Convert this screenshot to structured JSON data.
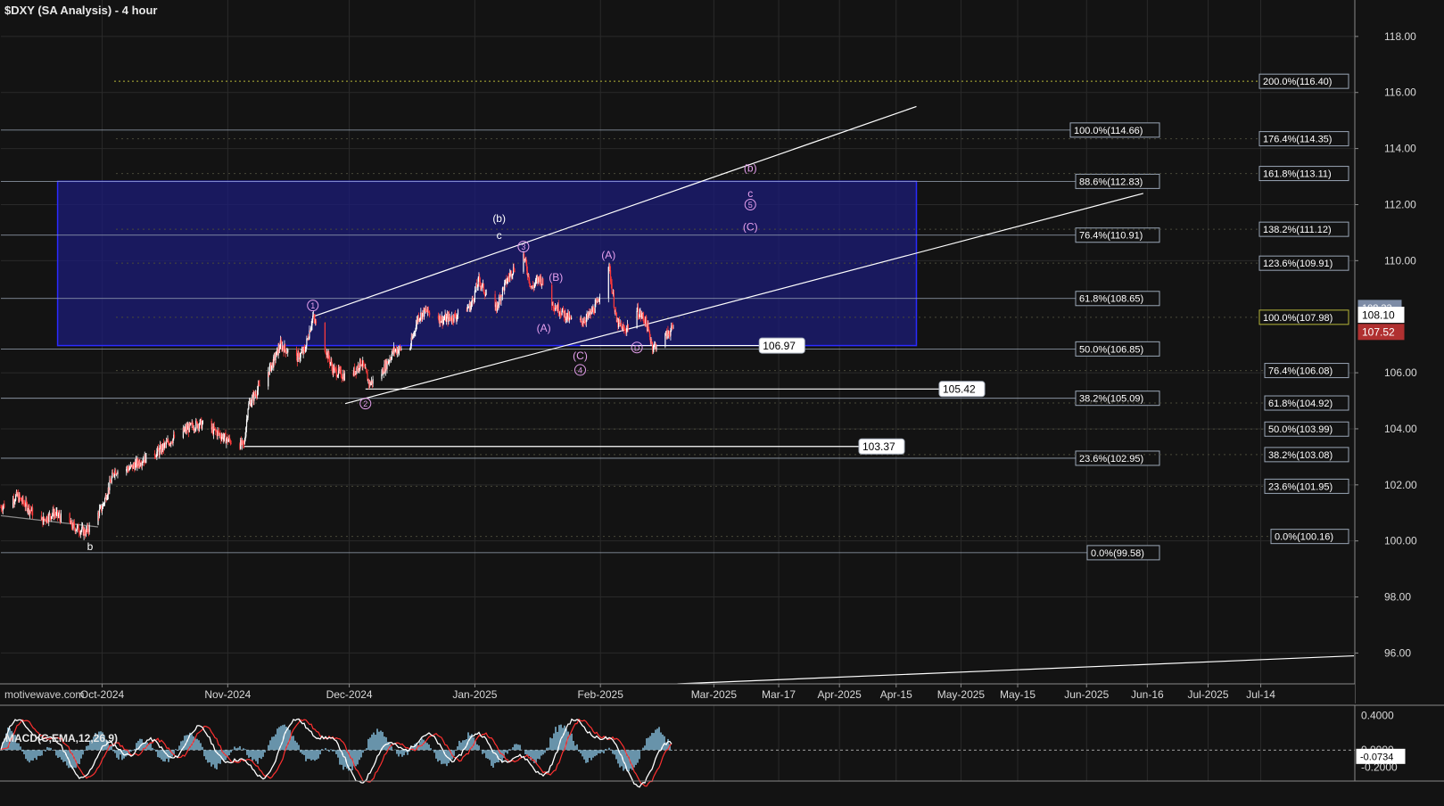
{
  "title": "$DXY (SA Analysis) - 4 hour",
  "watermark": "motivewave.com",
  "macd_title": "MACD(C,EMA,12,26,9)",
  "colors": {
    "background": "#131313",
    "grid": "#2a2a2a",
    "candle_up": "#ffffff",
    "candle_down": "#ff3b3b",
    "box_fill": "#1c1c78",
    "box_border": "#2a2aff",
    "fib_line": "#9aa6b6",
    "yellow_dotted": "#b5b53a",
    "wave_pink": "#e6a0ee",
    "wave_white": "#ffffff",
    "price_badge_red": "#b03030",
    "price_badge_gray": "#7d8ca6",
    "macd_line": "#ffffff",
    "signal_line": "#ff3030",
    "histogram": "#7fb4d0"
  },
  "chart_data": {
    "type": "line",
    "instrument": "$DXY",
    "timeframe": "4 hour",
    "x_axis": {
      "labels": [
        "Oct-2024",
        "Nov-2024",
        "Dec-2024",
        "Jan-2025",
        "Feb-2025",
        "Mar-2025",
        "Mar-17",
        "Apr-2025",
        "Apr-15",
        "May-2025",
        "May-15",
        "Jun-2025",
        "Jun-16",
        "Jul-2025",
        "Jul-14"
      ],
      "dates": [
        "2024-10-01",
        "2024-11-01",
        "2024-12-01",
        "2025-01-01",
        "2025-02-01",
        "2025-03-01",
        "2025-03-17",
        "2025-04-01",
        "2025-04-15",
        "2025-05-01",
        "2025-05-15",
        "2025-06-01",
        "2025-06-16",
        "2025-07-01",
        "2025-07-14"
      ]
    },
    "y_axis": {
      "ticks": [
        "118.00",
        "116.00",
        "114.00",
        "112.00",
        "110.00",
        "106.00",
        "104.00",
        "102.00",
        "100.00",
        "98.00",
        "96.00"
      ],
      "ylim": [
        94.9,
        119.3
      ]
    },
    "price_path": [
      {
        "date": "2024-09-06",
        "price": 101.2
      },
      {
        "date": "2024-09-10",
        "price": 101.6
      },
      {
        "date": "2024-09-12",
        "price": 101.3
      },
      {
        "date": "2024-09-16",
        "price": 100.7
      },
      {
        "date": "2024-09-19",
        "price": 101.0
      },
      {
        "date": "2024-09-24",
        "price": 100.5
      },
      {
        "date": "2024-09-27",
        "price": 100.3
      },
      {
        "date": "2024-10-01",
        "price": 101.2
      },
      {
        "date": "2024-10-04",
        "price": 102.5
      },
      {
        "date": "2024-10-08",
        "price": 102.6
      },
      {
        "date": "2024-10-11",
        "price": 102.9
      },
      {
        "date": "2024-10-15",
        "price": 103.2
      },
      {
        "date": "2024-10-18",
        "price": 103.6
      },
      {
        "date": "2024-10-22",
        "price": 104.0
      },
      {
        "date": "2024-10-25",
        "price": 104.2
      },
      {
        "date": "2024-10-29",
        "price": 103.9
      },
      {
        "date": "2024-11-01",
        "price": 103.6
      },
      {
        "date": "2024-11-05",
        "price": 103.4
      },
      {
        "date": "2024-11-06",
        "price": 104.8
      },
      {
        "date": "2024-11-08",
        "price": 105.3
      },
      {
        "date": "2024-11-12",
        "price": 106.3
      },
      {
        "date": "2024-11-14",
        "price": 107.0
      },
      {
        "date": "2024-11-18",
        "price": 106.5
      },
      {
        "date": "2024-11-20",
        "price": 106.8
      },
      {
        "date": "2024-11-22",
        "price": 108.0
      },
      {
        "date": "2024-11-25",
        "price": 106.9
      },
      {
        "date": "2024-11-27",
        "price": 106.1
      },
      {
        "date": "2024-12-01",
        "price": 105.8
      },
      {
        "date": "2024-12-04",
        "price": 106.4
      },
      {
        "date": "2024-12-06",
        "price": 105.6
      },
      {
        "date": "2024-12-09",
        "price": 106.0
      },
      {
        "date": "2024-12-12",
        "price": 106.8
      },
      {
        "date": "2024-12-16",
        "price": 106.9
      },
      {
        "date": "2024-12-18",
        "price": 108.0
      },
      {
        "date": "2024-12-20",
        "price": 108.2
      },
      {
        "date": "2024-12-24",
        "price": 107.9
      },
      {
        "date": "2024-12-27",
        "price": 108.0
      },
      {
        "date": "2024-12-31",
        "price": 108.4
      },
      {
        "date": "2025-01-02",
        "price": 109.3
      },
      {
        "date": "2025-01-06",
        "price": 108.2
      },
      {
        "date": "2025-01-08",
        "price": 109.0
      },
      {
        "date": "2025-01-10",
        "price": 109.6
      },
      {
        "date": "2025-01-13",
        "price": 110.2
      },
      {
        "date": "2025-01-15",
        "price": 109.0
      },
      {
        "date": "2025-01-17",
        "price": 109.4
      },
      {
        "date": "2025-01-20",
        "price": 108.5
      },
      {
        "date": "2025-01-23",
        "price": 108.1
      },
      {
        "date": "2025-01-26",
        "price": 107.7
      },
      {
        "date": "2025-01-29",
        "price": 108.0
      },
      {
        "date": "2025-01-31",
        "price": 108.4
      },
      {
        "date": "2025-02-03",
        "price": 109.9
      },
      {
        "date": "2025-02-05",
        "price": 107.8
      },
      {
        "date": "2025-02-07",
        "price": 107.5
      },
      {
        "date": "2025-02-10",
        "price": 108.2
      },
      {
        "date": "2025-02-12",
        "price": 107.9
      },
      {
        "date": "2025-02-14",
        "price": 106.9
      },
      {
        "date": "2025-02-17",
        "price": 107.3
      },
      {
        "date": "2025-02-19",
        "price": 107.6
      }
    ],
    "price_labels": {
      "current": "107.52",
      "marker": "108.10",
      "hidden": "108.33"
    },
    "support_levels": [
      {
        "label": "106.97",
        "value": 106.97
      },
      {
        "label": "105.42",
        "value": 105.42
      },
      {
        "label": "103.37",
        "value": 103.37
      }
    ],
    "target_box": {
      "top": 112.83,
      "bottom": 106.97,
      "start": "2024-09-20",
      "end": "2025-04-20"
    },
    "fib_left": [
      {
        "label": "100.0%(114.66)",
        "value": 114.66
      },
      {
        "label": "88.6%(112.83)",
        "value": 112.83
      },
      {
        "label": "76.4%(110.91)",
        "value": 110.91
      },
      {
        "label": "61.8%(108.65)",
        "value": 108.65
      },
      {
        "label": "50.0%(106.85)",
        "value": 106.85
      },
      {
        "label": "38.2%(105.09)",
        "value": 105.09
      },
      {
        "label": "23.6%(102.95)",
        "value": 102.95
      },
      {
        "label": "0.0%(99.58)",
        "value": 99.58
      }
    ],
    "fib_right": [
      {
        "label": "200.0%(116.40)",
        "value": 116.4
      },
      {
        "label": "176.4%(114.35)",
        "value": 114.35
      },
      {
        "label": "161.8%(113.11)",
        "value": 113.11
      },
      {
        "label": "138.2%(111.12)",
        "value": 111.12
      },
      {
        "label": "123.6%(109.91)",
        "value": 109.91
      },
      {
        "label": "100.0%(107.98)",
        "value": 107.98
      },
      {
        "label": "76.4%(106.08)",
        "value": 106.08
      },
      {
        "label": "61.8%(104.92)",
        "value": 104.92
      },
      {
        "label": "50.0%(103.99)",
        "value": 103.99
      },
      {
        "label": "38.2%(103.08)",
        "value": 103.08
      },
      {
        "label": "23.6%(101.95)",
        "value": 101.95
      },
      {
        "label": "0.0%(100.16)",
        "value": 100.16
      }
    ],
    "channel_lines": [
      {
        "from": {
          "date": "2024-11-22",
          "price": 108.0
        },
        "to": {
          "date": "2025-04-20",
          "price": 115.5
        }
      },
      {
        "from": {
          "date": "2024-11-30",
          "price": 104.9
        },
        "to": {
          "date": "2025-06-15",
          "price": 112.4
        }
      },
      {
        "from": {
          "date": "2025-02-20",
          "price": 94.9
        },
        "to": {
          "date": "2025-08-06",
          "price": 95.9
        }
      },
      {
        "from": {
          "date": "2024-09-06",
          "price": 100.9
        },
        "to": {
          "date": "2024-09-30",
          "price": 100.5
        }
      }
    ],
    "wave_labels": [
      {
        "text": "b",
        "date": "2024-09-28",
        "price": 99.8,
        "color": "white",
        "circle": false
      },
      {
        "text": "1",
        "date": "2024-11-22",
        "price": 108.4,
        "color": "pink",
        "circle": true
      },
      {
        "text": "2",
        "date": "2024-12-05",
        "price": 104.9,
        "color": "pink",
        "circle": true
      },
      {
        "text": "3",
        "date": "2025-01-13",
        "price": 110.5,
        "color": "pink",
        "circle": true
      },
      {
        "text": "4",
        "date": "2025-01-27",
        "price": 106.1,
        "color": "pink",
        "circle": true
      },
      {
        "text": "5",
        "date": "2025-03-10",
        "price": 112.0,
        "color": "pink",
        "circle": true
      },
      {
        "text": "(b)",
        "date": "2025-01-07",
        "price": 111.5,
        "color": "white",
        "circle": false
      },
      {
        "text": "c",
        "date": "2025-01-07",
        "price": 110.9,
        "color": "white",
        "circle": false
      },
      {
        "text": "(b)",
        "date": "2025-03-10",
        "price": 113.3,
        "color": "pink",
        "circle": false
      },
      {
        "text": "c",
        "date": "2025-03-10",
        "price": 112.4,
        "color": "pink",
        "circle": false
      },
      {
        "text": "(C)",
        "date": "2025-03-10",
        "price": 111.2,
        "color": "pink",
        "circle": false
      },
      {
        "text": "(A)",
        "date": "2025-02-03",
        "price": 110.2,
        "color": "pink",
        "circle": false
      },
      {
        "text": "(B)",
        "date": "2025-01-21",
        "price": 109.4,
        "color": "pink",
        "circle": false
      },
      {
        "text": "(A)",
        "date": "2025-01-18",
        "price": 107.6,
        "color": "pink",
        "circle": false
      },
      {
        "text": "(C)",
        "date": "2025-01-27",
        "price": 106.6,
        "color": "pink",
        "circle": false
      },
      {
        "text": "D",
        "date": "2025-02-10",
        "price": 106.9,
        "color": "pink",
        "circle": true
      }
    ],
    "macd": {
      "params": "C,EMA,12,26,9",
      "ticks": [
        "0.4000",
        "0.0000",
        "-0.2000"
      ],
      "ylim": [
        -0.36,
        0.52
      ],
      "value_label": "-0.0734"
    }
  }
}
